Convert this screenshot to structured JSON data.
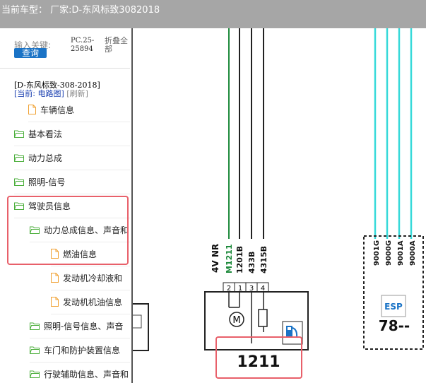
{
  "window": {
    "title": "当前车型：  厂家:D-东风标致3082018"
  },
  "search": {
    "label": "输入关键:",
    "button": "查询",
    "code_line1": "PC.25-",
    "code_line2": "25894",
    "fold_line1": "折叠全",
    "fold_line2": "部"
  },
  "car": {
    "title": "[D-东风标致-308-2018]",
    "current_label": "[当前:",
    "current_value": "电路图]",
    "refresh": "[刷新]"
  },
  "tree": [
    {
      "label": "车辆信息",
      "icon": "file-icon"
    },
    {
      "label": "基本看法",
      "icon": "folder-icon"
    },
    {
      "label": "动力总成",
      "icon": "folder-icon"
    },
    {
      "label": "照明-信号",
      "icon": "folder-icon"
    },
    {
      "label": "驾驶员信息",
      "icon": "folder-icon"
    },
    {
      "label": "动力总成信息、声音和",
      "icon": "folder-icon"
    },
    {
      "label": "燃油信息",
      "icon": "file-icon"
    },
    {
      "label": "发动机冷却液和",
      "icon": "file-icon"
    },
    {
      "label": "发动机机油信息",
      "icon": "file-icon"
    },
    {
      "label": "照明-信号信息、声音",
      "icon": "folder-icon"
    },
    {
      "label": "车门和防护装置信息",
      "icon": "folder-icon"
    },
    {
      "label": "行驶辅助信息、声音和",
      "icon": "folder-icon"
    }
  ],
  "diagram": {
    "wires": [
      "M1211",
      "1201B",
      "433B",
      "4315B"
    ],
    "pins": [
      "2",
      "1",
      "3",
      "4"
    ],
    "nr_label": "4V NR",
    "motor": "M",
    "component_id": "1211",
    "esp_wires": [
      "9001G",
      "9000G",
      "9001A",
      "9000A"
    ],
    "esp_label": "ESP",
    "esp_id": "78--",
    "colors": {
      "green": "#1e8a3c",
      "cyan": "#37d9d9",
      "highlight": "#e8606a",
      "blue": "#1a73c6"
    }
  }
}
